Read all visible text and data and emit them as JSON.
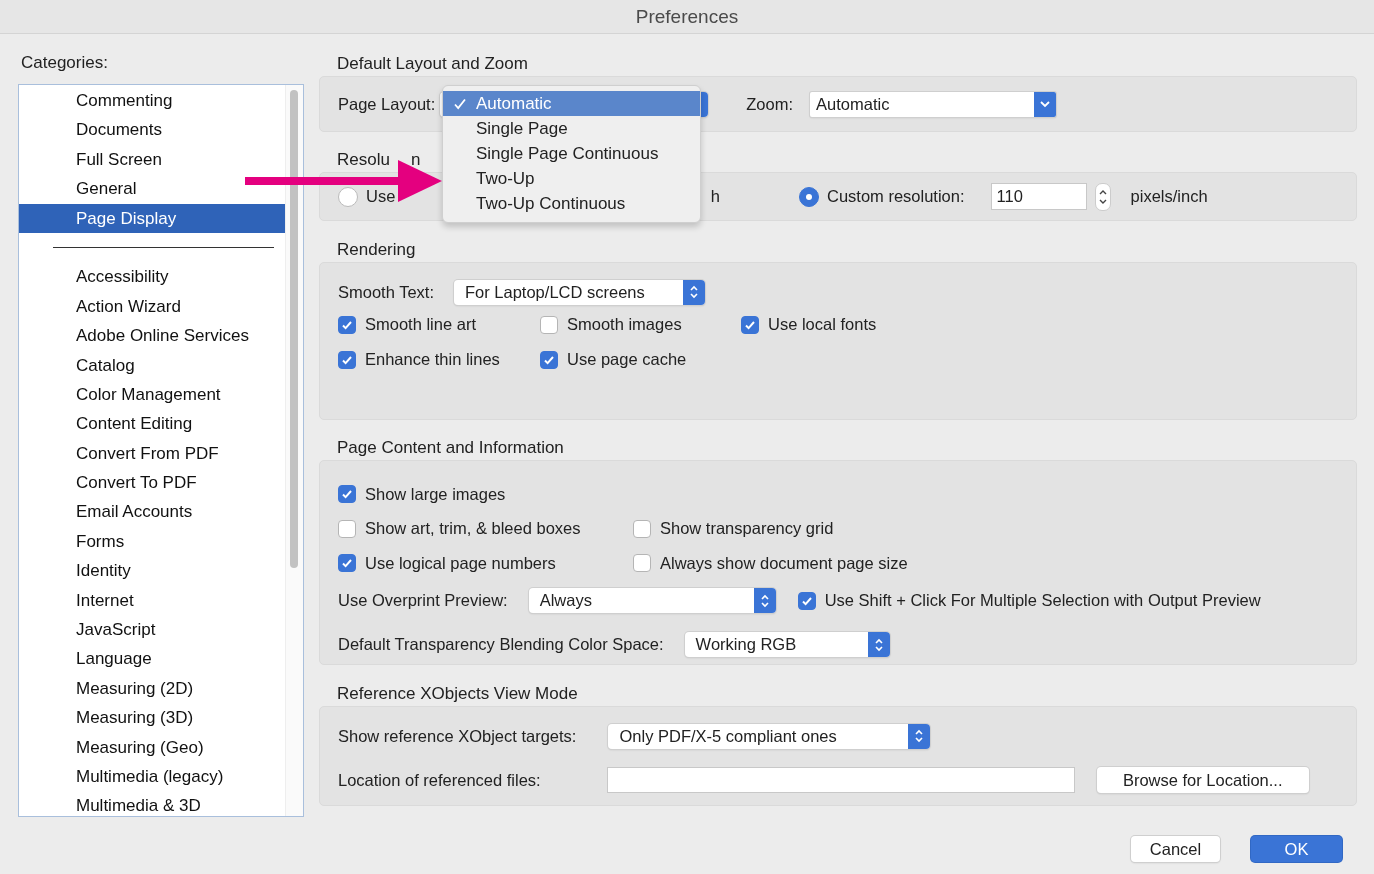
{
  "window": {
    "title": "Preferences"
  },
  "sidebar": {
    "label": "Categories:",
    "groups": [
      [
        {
          "label": "Commenting",
          "selected": false
        },
        {
          "label": "Documents",
          "selected": false
        },
        {
          "label": "Full Screen",
          "selected": false
        },
        {
          "label": "General",
          "selected": false
        },
        {
          "label": "Page Display",
          "selected": true
        }
      ],
      [
        {
          "label": "Accessibility",
          "selected": false
        },
        {
          "label": "Action Wizard",
          "selected": false
        },
        {
          "label": "Adobe Online Services",
          "selected": false
        },
        {
          "label": "Catalog",
          "selected": false
        },
        {
          "label": "Color Management",
          "selected": false
        },
        {
          "label": "Content Editing",
          "selected": false
        },
        {
          "label": "Convert From PDF",
          "selected": false
        },
        {
          "label": "Convert To PDF",
          "selected": false
        },
        {
          "label": "Email Accounts",
          "selected": false
        },
        {
          "label": "Forms",
          "selected": false
        },
        {
          "label": "Identity",
          "selected": false
        },
        {
          "label": "Internet",
          "selected": false
        },
        {
          "label": "JavaScript",
          "selected": false
        },
        {
          "label": "Language",
          "selected": false
        },
        {
          "label": "Measuring (2D)",
          "selected": false
        },
        {
          "label": "Measuring (3D)",
          "selected": false
        },
        {
          "label": "Measuring (Geo)",
          "selected": false
        },
        {
          "label": "Multimedia (legacy)",
          "selected": false
        },
        {
          "label": "Multimedia & 3D",
          "selected": false
        }
      ]
    ]
  },
  "layout_zoom": {
    "heading": "Default Layout and Zoom",
    "page_layout": {
      "label": "Page Layout:",
      "menu": [
        {
          "label": "Automatic",
          "selected": true
        },
        {
          "label": "Single Page",
          "selected": false
        },
        {
          "label": "Single Page Continuous",
          "selected": false
        },
        {
          "label": "Two-Up",
          "selected": false
        },
        {
          "label": "Two-Up Continuous",
          "selected": false
        }
      ]
    },
    "zoom": {
      "label": "Zoom:",
      "value": "Automatic"
    }
  },
  "resolution": {
    "heading": "Resolu",
    "heading_end": "n",
    "options": [
      {
        "label": "Use",
        "label_end": "h",
        "selected": false
      },
      {
        "label": "Custom resolution:",
        "selected": true
      }
    ],
    "value": "110",
    "unit": "pixels/inch"
  },
  "rendering": {
    "heading": "Rendering",
    "smooth_text": {
      "label": "Smooth Text:",
      "value": "For Laptop/LCD screens"
    },
    "checkbox_rows": [
      [
        {
          "label": "Smooth line art",
          "checked": true
        },
        {
          "label": "Smooth images",
          "checked": false
        },
        {
          "label": "Use local fonts",
          "checked": true
        }
      ],
      [
        {
          "label": "Enhance thin lines",
          "checked": true
        },
        {
          "label": "Use page cache",
          "checked": true
        }
      ]
    ]
  },
  "page_content": {
    "heading": "Page Content and Information",
    "checkbox_rows": [
      [
        {
          "label": "Show large images",
          "checked": true
        }
      ],
      [
        {
          "label": "Show art, trim, & bleed boxes",
          "checked": false
        },
        {
          "label": "Show transparency grid",
          "checked": false
        }
      ],
      [
        {
          "label": "Use logical page numbers",
          "checked": true
        },
        {
          "label": "Always show document page size",
          "checked": false
        }
      ]
    ],
    "overprint": {
      "label": "Use Overprint Preview:",
      "value": "Always"
    },
    "shift_click": {
      "label": "Use Shift + Click For Multiple Selection with Output Preview",
      "checked": true
    },
    "blending": {
      "label": "Default Transparency Blending Color Space:",
      "value": "Working RGB"
    }
  },
  "reference": {
    "heading": "Reference XObjects View Mode",
    "targets": {
      "label": "Show reference XObject targets:",
      "value": "Only PDF/X-5 compliant ones"
    },
    "location": {
      "label": "Location of referenced files:",
      "button": "Browse for Location..."
    }
  },
  "buttons": [
    {
      "label": "Cancel",
      "kind": "secondary"
    },
    {
      "label": "OK",
      "kind": "primary"
    }
  ]
}
